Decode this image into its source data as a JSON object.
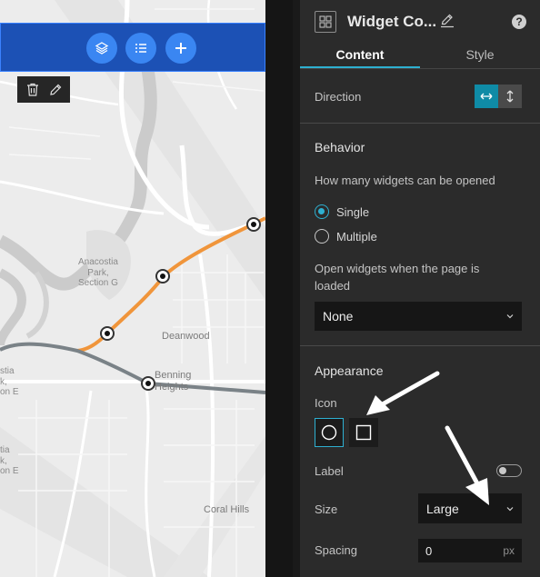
{
  "map": {
    "labels": {
      "anacostia_park": "Anacostia\nPark,\nSection G",
      "deanwood": "Deanwood",
      "benning_heights": "Benning\nHeights",
      "coral_hills": "Coral Hills",
      "left_partial_1": "stia\nk,\non E",
      "left_partial_2": "tia\nk,\non E"
    },
    "colors": {
      "orange_line": "#f0953b",
      "gray_line": "#7a8287",
      "water": "#c9c9c9",
      "land": "#ececec"
    }
  },
  "controller": {
    "buttons": [
      {
        "icon": "layers-icon"
      },
      {
        "icon": "list-icon"
      },
      {
        "icon": "plus-icon"
      }
    ],
    "color": "#1c51b5"
  },
  "map_toolbar": {
    "buttons": [
      {
        "icon": "trash-icon"
      },
      {
        "icon": "pencil-icon"
      }
    ]
  },
  "panel": {
    "header": {
      "title": "Widget Co...",
      "help": "?"
    },
    "tabs": [
      {
        "label": "Content",
        "active": true
      },
      {
        "label": "Style",
        "active": false
      }
    ],
    "direction": {
      "label": "Direction",
      "options": [
        "horizontal",
        "vertical"
      ],
      "selected": "horizontal"
    },
    "behavior": {
      "title": "Behavior",
      "question": "How many widgets can be opened",
      "options": [
        {
          "label": "Single",
          "checked": true
        },
        {
          "label": "Multiple",
          "checked": false
        }
      ],
      "open_label_line1": "Open widgets when the page is",
      "open_label_line2": "loaded",
      "open_value": "None"
    },
    "appearance": {
      "title": "Appearance",
      "icon_label": "Icon",
      "icon_options": [
        "circle",
        "square"
      ],
      "icon_selected": "circle",
      "label_label": "Label",
      "label_enabled": false,
      "size_label": "Size",
      "size_value": "Large",
      "spacing_label": "Spacing",
      "spacing_value": "0",
      "spacing_unit": "px"
    },
    "accent_color": "#2eb0d1"
  }
}
